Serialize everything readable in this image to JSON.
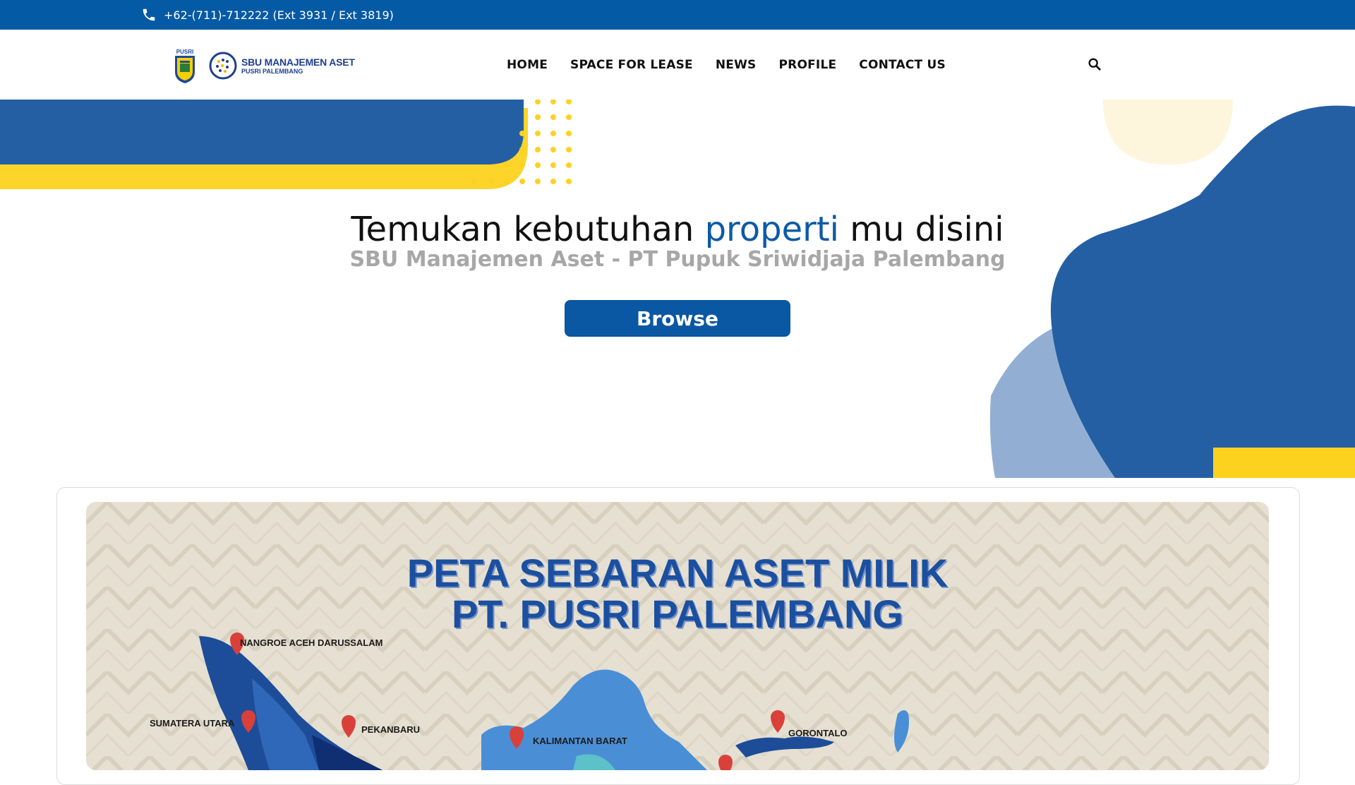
{
  "topbar": {
    "phone": "+62-(711)-712222 (Ext 3931 / Ext 3819)"
  },
  "logo": {
    "pusri_text": "PUSRI",
    "sbu_line1": "SBU MANAJEMEN ASET",
    "sbu_line2": "PUSRI PALEMBANG"
  },
  "nav": {
    "items": [
      "HOME",
      "SPACE FOR LEASE",
      "NEWS",
      "PROFILE",
      "CONTACT US"
    ]
  },
  "hero": {
    "title_pre": "Temukan kebutuhan ",
    "title_accent": "properti",
    "title_post": " mu disini",
    "subtitle": "SBU Manajemen Aset - PT Pupuk Sriwidjaja Palembang",
    "button": "Browse"
  },
  "map": {
    "title_line1": "PETA SEBARAN ASET MILIK",
    "title_line2": "PT. PUSRI PALEMBANG",
    "locations": [
      "NANGROE ACEH DARUSSALAM",
      "SUMATERA UTARA",
      "PEKANBARU",
      "KALIMANTAN BARAT",
      "GORONTALO"
    ]
  },
  "colors": {
    "primary": "#055aa5",
    "hero_blue": "#245fa3",
    "yellow": "#fdd21f",
    "light_blue": "#92afd3"
  }
}
